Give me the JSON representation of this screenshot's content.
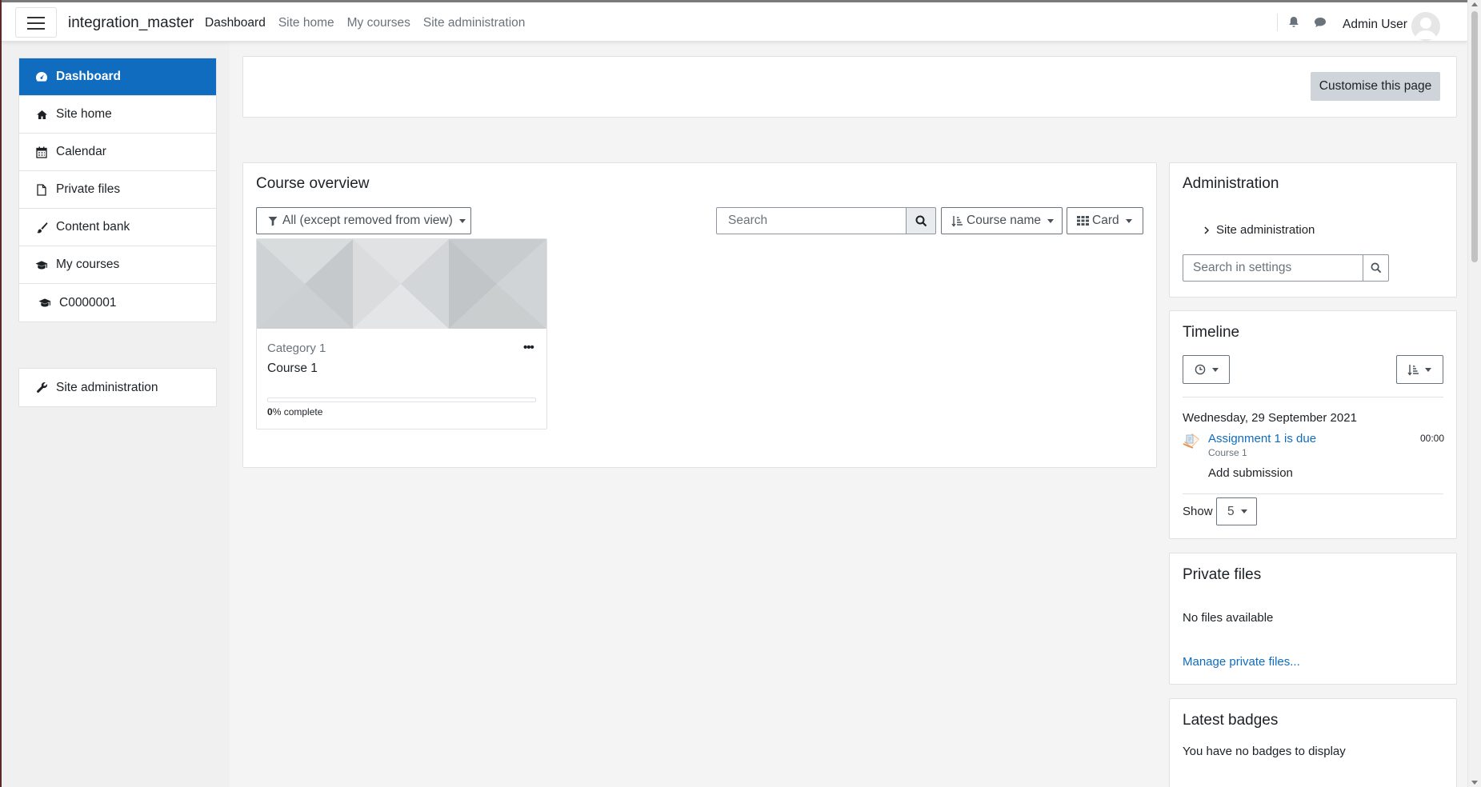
{
  "navbar": {
    "brand": "integration_master",
    "links": [
      "Dashboard",
      "Site home",
      "My courses",
      "Site administration"
    ],
    "user_name": "Admin User",
    "icons": [
      "menu-icon",
      "bell-icon",
      "chat-icon",
      "avatar"
    ]
  },
  "drawer": {
    "items": [
      {
        "label": "Dashboard",
        "icon": "dashboard-icon"
      },
      {
        "label": "Site home",
        "icon": "home-icon"
      },
      {
        "label": "Calendar",
        "icon": "calendar-icon"
      },
      {
        "label": "Private files",
        "icon": "file-icon"
      },
      {
        "label": "Content bank",
        "icon": "brush-icon"
      },
      {
        "label": "My courses",
        "icon": "graduation-cap-icon"
      },
      {
        "label": "C0000001",
        "icon": "graduation-cap-icon"
      }
    ],
    "admin_item": {
      "label": "Site administration",
      "icon": "wrench-icon"
    }
  },
  "page_header": {
    "customise_label": "Customise this page"
  },
  "course_overview": {
    "title": "Course overview",
    "filter_label": "All (except removed from view)",
    "search_placeholder": "Search",
    "sort_label": "Course name",
    "view_label": "Card",
    "courses": [
      {
        "category": "Category 1",
        "name": "Course 1",
        "progress_percent": "0",
        "progress_suffix": "% complete",
        "progress_value": 0
      }
    ]
  },
  "administration": {
    "title": "Administration",
    "node_label": "Site administration",
    "search_placeholder": "Search in settings"
  },
  "timeline": {
    "title": "Timeline",
    "date_heading": "Wednesday, 29 September 2021",
    "event": {
      "title": "Assignment 1 is due",
      "course": "Course 1",
      "time": "00:00",
      "action": "Add submission"
    },
    "show_label": "Show",
    "show_value": "5"
  },
  "private_files": {
    "title": "Private files",
    "empty_text": "No files available",
    "manage_link": "Manage private files..."
  },
  "latest_badges": {
    "title": "Latest badges",
    "empty_text": "You have no badges to display"
  },
  "colors": {
    "accent": "#0f6cbf",
    "secondary_button": "#ced4da"
  }
}
